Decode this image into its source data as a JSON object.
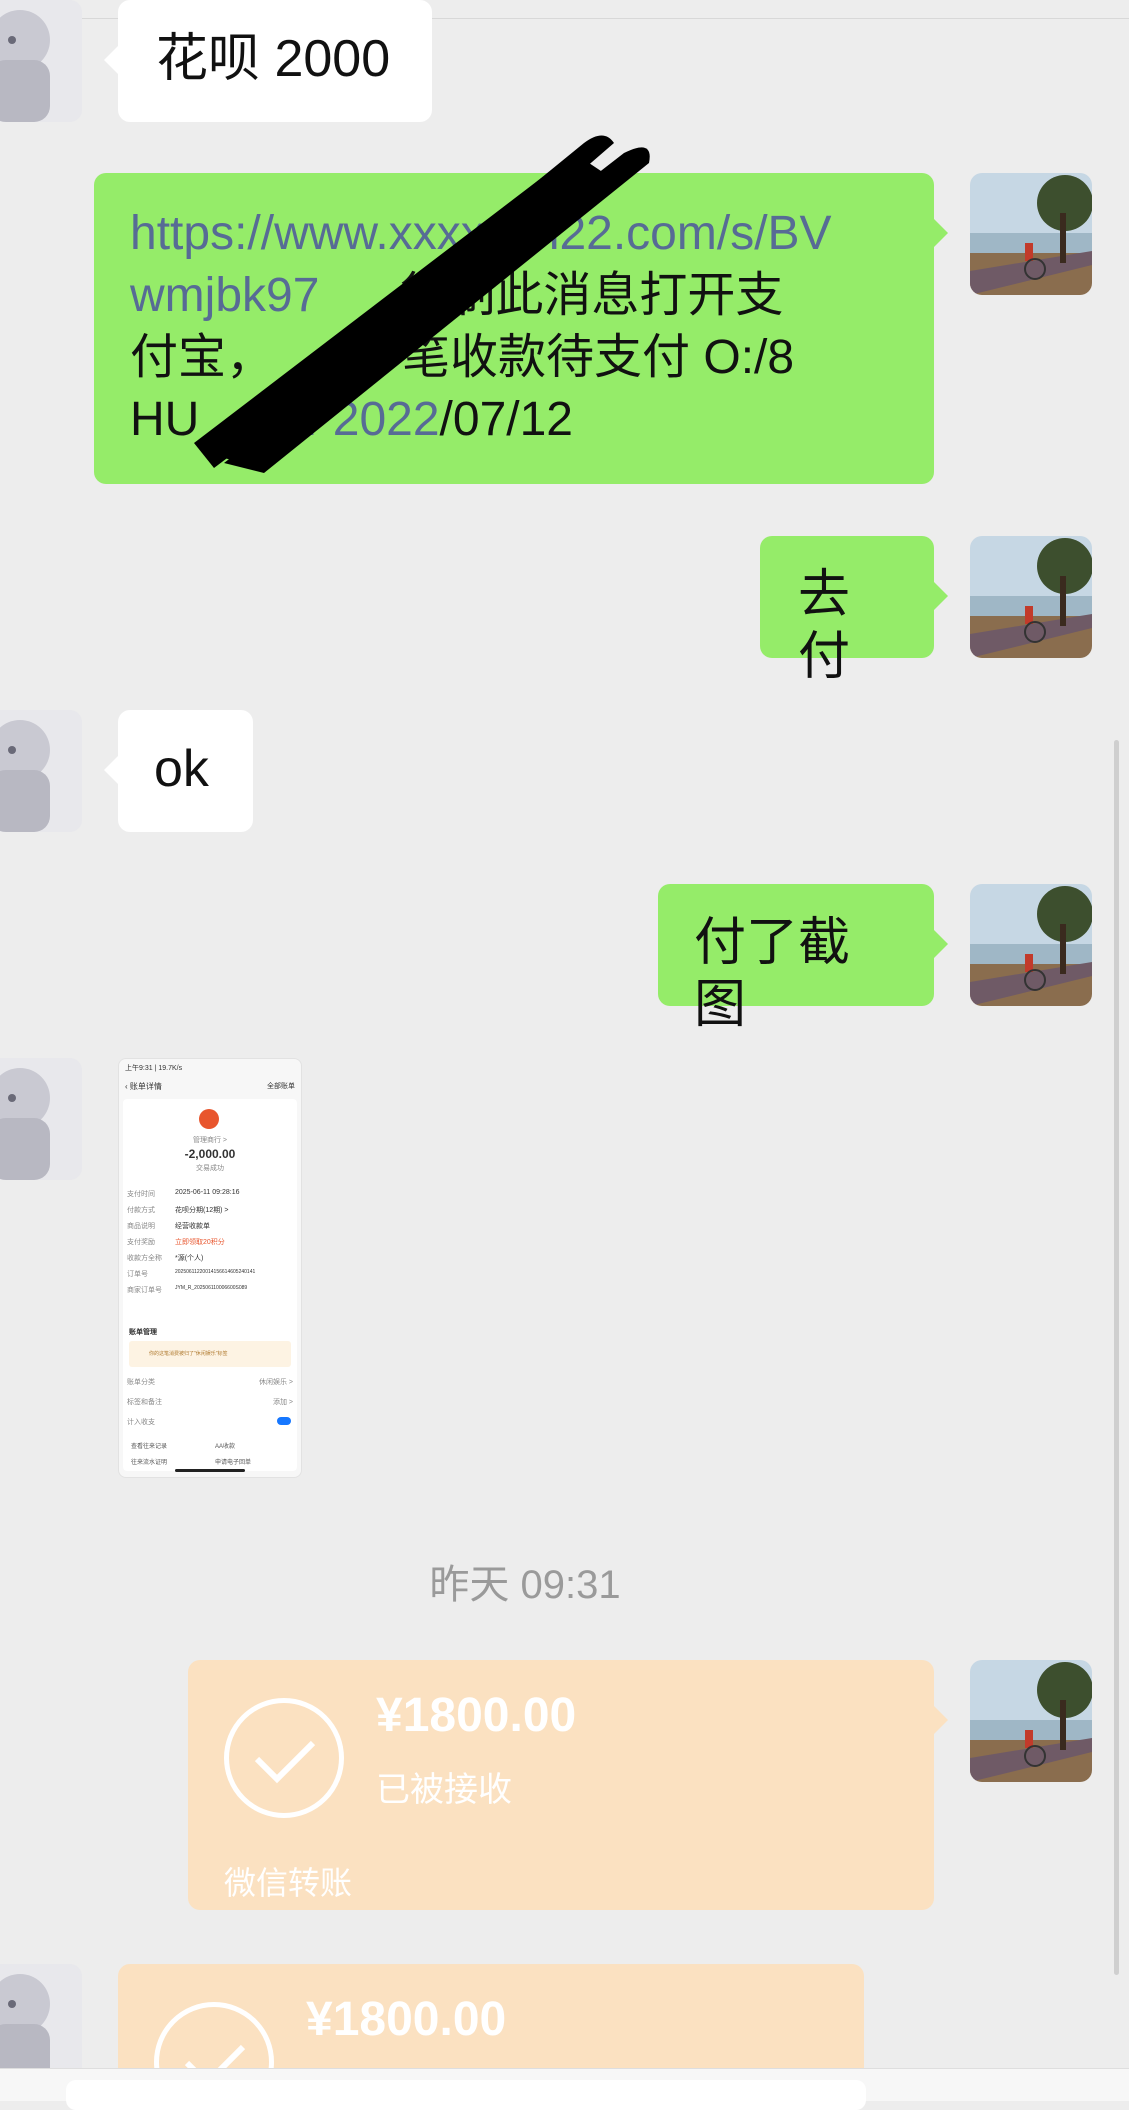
{
  "messages": {
    "m1": {
      "text": "花呗 2000"
    },
    "m2": {
      "link_line1": "https://www.",
      "link_hidden": "xxxxxx",
      "link_line1b": "n22.com/s/BV",
      "link_line2": "wmjbk97",
      "text_line2": "复制此消息打开支",
      "text_line3a": "付宝，",
      "text_line3b": "一笔收款待支付  O:/8",
      "text_line4a": "HU",
      "link_line4": "34 2022",
      "text_line4b": "/07/12"
    },
    "m3": {
      "text": "去付"
    },
    "m4": {
      "text": "ok"
    },
    "m5": {
      "text": "付了截图"
    }
  },
  "screenshot": {
    "status_left": "上午9:31 | 19.7K/s",
    "title": "账单详情",
    "right_link": "全部账单",
    "merchant": "管理商行 >",
    "amount": "-2,000.00",
    "state": "交易成功",
    "rows": [
      {
        "k": "支付时间",
        "v": "2025-06-11 09:28:16"
      },
      {
        "k": "付款方式",
        "v": "花呗分期(12期) >"
      },
      {
        "k": "商品说明",
        "v": "经营收款单"
      },
      {
        "k": "支付奖励",
        "v": "立即领取20积分"
      },
      {
        "k": "收款方全称",
        "v": "*源(个人)"
      },
      {
        "k": "订单号",
        "v": "20250611220014156614605240141"
      },
      {
        "k": "商家订单号",
        "v": "JYM_R_202506110006600S089"
      }
    ],
    "section": "账单管理",
    "tip": "你的这笔消费被归了\"休闲娱乐\"标签",
    "m_rows": [
      {
        "k": "账单分类",
        "v": "休闲娱乐 >"
      },
      {
        "k": "标签和备注",
        "v": "添加 >"
      },
      {
        "k": "计入收支",
        "v": ""
      }
    ],
    "links": [
      "查看往来记录",
      "AA收款",
      "往来流水证明",
      "申请电子回单"
    ]
  },
  "timestamp": "昨天 09:31",
  "transfer1": {
    "amount": "¥1800.00",
    "status": "已被接收",
    "footer": "微信转账"
  },
  "transfer2": {
    "amount": "¥1800.00"
  }
}
